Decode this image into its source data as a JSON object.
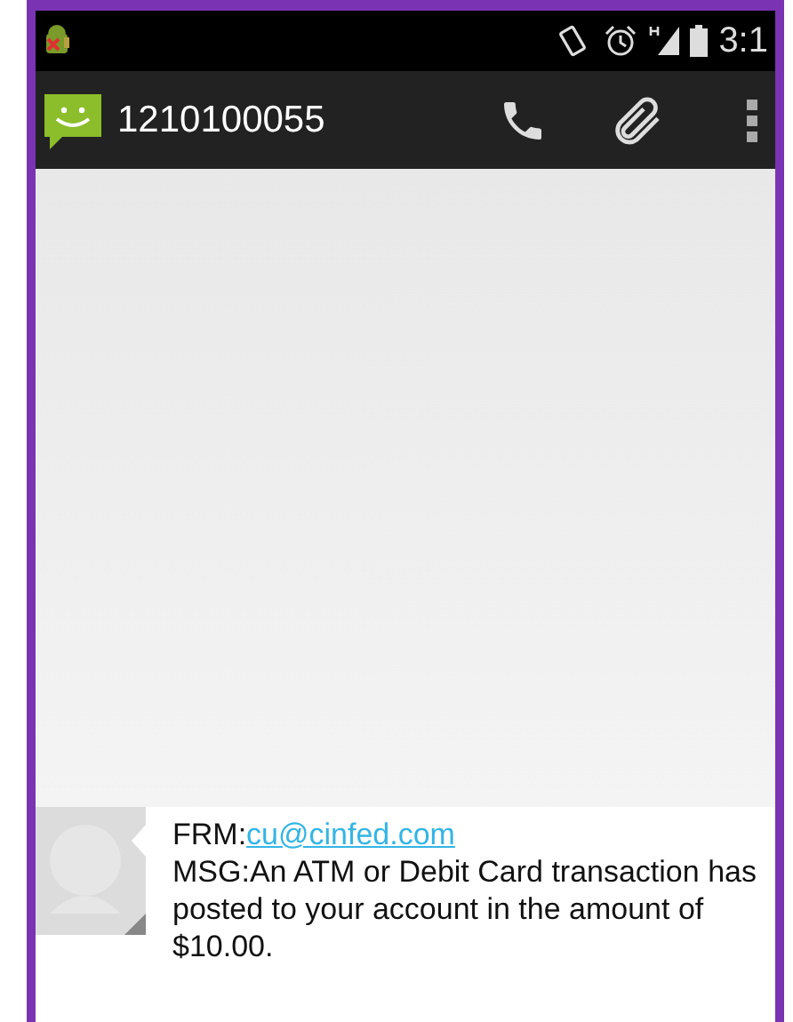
{
  "status_bar": {
    "time": "3:1"
  },
  "action_bar": {
    "title": "1210100055"
  },
  "message": {
    "from_label": "FRM:",
    "from_link": "cu@cinfed.com",
    "body": "MSG:An ATM or Debit Card transaction has posted to your account in the amount of $10.00."
  }
}
